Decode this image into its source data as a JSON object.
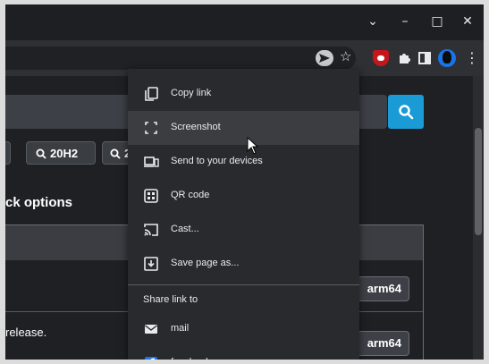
{
  "window": {
    "controls": {
      "tabs": "⌄",
      "minimize": "–",
      "maximize": "□",
      "close": "✕"
    }
  },
  "toolbar": {
    "star": "☆",
    "kebab": "⋮",
    "extensions": [
      "ublock-origin-icon",
      "puzzle-icon",
      "side-panel-icon",
      "profile-avatar"
    ]
  },
  "page": {
    "chips": [
      {
        "label": "1"
      },
      {
        "label": "20H2"
      },
      {
        "label": "2"
      }
    ],
    "heading": "ck options",
    "release_text": "release.",
    "arch_buttons": [
      "arm64",
      "arm64"
    ]
  },
  "menu": {
    "items": [
      {
        "label": "Copy link",
        "icon": "copy-link-icon"
      },
      {
        "label": "Screenshot",
        "icon": "screenshot-icon"
      },
      {
        "label": "Send to your devices",
        "icon": "send-to-devices-icon"
      },
      {
        "label": "QR code",
        "icon": "qr-code-icon"
      },
      {
        "label": "Cast...",
        "icon": "cast-icon"
      },
      {
        "label": "Save page as...",
        "icon": "save-page-icon"
      }
    ],
    "section_label": "Share link to",
    "share_targets": [
      {
        "label": "mail",
        "icon": "mail-icon"
      },
      {
        "label": "facebook",
        "icon": "facebook-icon"
      }
    ]
  },
  "colors": {
    "accent": "#1a9bd6",
    "window_bg": "#202124",
    "menu_bg": "#292a2d",
    "menu_hover": "#3c3d41",
    "ublock_red": "#c5161d",
    "facebook_blue": "#1877f2"
  }
}
